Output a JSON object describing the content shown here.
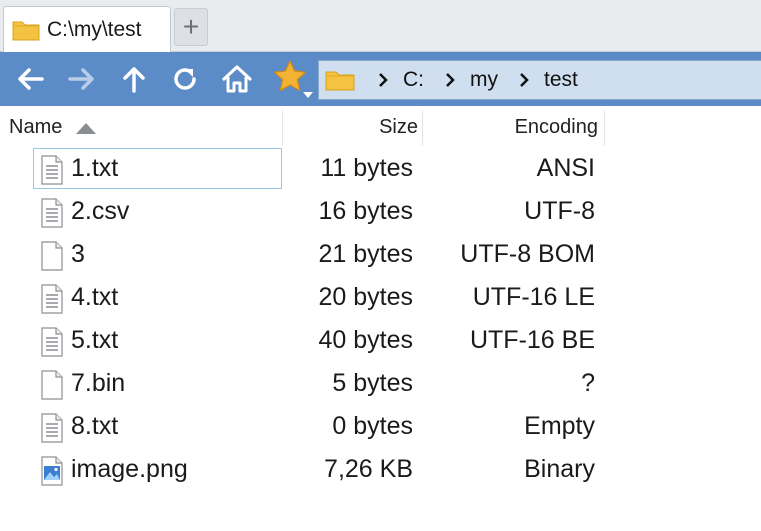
{
  "tab": {
    "title": "C:\\my\\test",
    "new_tab_label": "+"
  },
  "address": {
    "crumbs": [
      "C:",
      "my",
      "test"
    ]
  },
  "columns": {
    "name": "Name",
    "size": "Size",
    "encoding": "Encoding"
  },
  "files": [
    {
      "name": "1.txt",
      "size": "11 bytes",
      "encoding": "ANSI",
      "icon": "text-file-icon",
      "selected": true
    },
    {
      "name": "2.csv",
      "size": "16 bytes",
      "encoding": "UTF-8",
      "icon": "text-file-icon"
    },
    {
      "name": "3",
      "size": "21 bytes",
      "encoding": "UTF-8 BOM",
      "icon": "blank-file-icon"
    },
    {
      "name": "4.txt",
      "size": "20 bytes",
      "encoding": "UTF-16 LE",
      "icon": "text-file-icon"
    },
    {
      "name": "5.txt",
      "size": "40 bytes",
      "encoding": "UTF-16 BE",
      "icon": "text-file-icon"
    },
    {
      "name": "7.bin",
      "size": "5 bytes",
      "encoding": "?",
      "icon": "blank-file-icon"
    },
    {
      "name": "8.txt",
      "size": "0 bytes",
      "encoding": "Empty",
      "icon": "text-file-icon"
    },
    {
      "name": "image.png",
      "size": "7,26 KB",
      "encoding": "Binary",
      "icon": "image-file-icon"
    }
  ],
  "colors": {
    "toolbar": "#5b8cc7",
    "address_bg": "#cfdff0",
    "folder": "#f5c342",
    "star": "#f2b233",
    "selection_border": "#99c9e8"
  }
}
